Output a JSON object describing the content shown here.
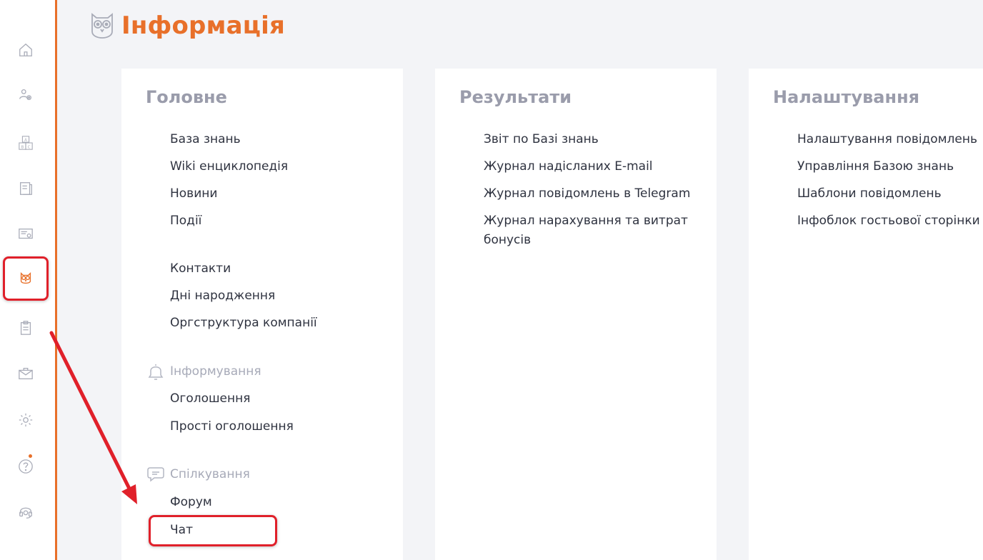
{
  "header": {
    "title": "Інформація",
    "icon": "owl-icon"
  },
  "sidebar": {
    "accent": "#e8702a",
    "items": [
      {
        "name": "home-icon"
      },
      {
        "name": "users-settings-icon"
      },
      {
        "name": "abc-blocks-icon"
      },
      {
        "name": "notebook-icon"
      },
      {
        "name": "certificate-icon"
      },
      {
        "name": "owl-icon",
        "active": true
      },
      {
        "name": "clipboard-icon"
      },
      {
        "name": "mail-icon"
      },
      {
        "name": "gear-icon"
      },
      {
        "name": "help-icon",
        "notification": true
      },
      {
        "name": "support-icon"
      }
    ]
  },
  "cards": {
    "main": {
      "title": "Головне",
      "links": [
        "База знань",
        "Wiki енциклопедія",
        "Новини",
        "Події"
      ],
      "links2": [
        "Контакти",
        "Дні народження",
        "Оргструктура компанії"
      ],
      "informing": {
        "title": "Інформування",
        "icon": "bell-icon",
        "links": [
          "Оголошення",
          "Прості оголошення"
        ]
      },
      "communication": {
        "title": "Спілкування",
        "icon": "chat-bubbles-icon",
        "links": [
          "Форум",
          "Чат"
        ]
      }
    },
    "results": {
      "title": "Результати",
      "links": [
        "Звіт по Базі знань",
        "Журнал надісланих E-mail",
        "Журнал повідомлень в Telegram",
        "Журнал нарахування та витрат",
        "бонусів"
      ]
    },
    "settings": {
      "title": "Налаштування",
      "links": [
        "Налаштування повідомлень",
        "Управління Базою знань",
        "Шаблони повідомлень",
        "Інфоблок гостьової сторінки"
      ]
    }
  },
  "colors": {
    "accent": "#e8702a",
    "annotation": "#e0202a",
    "muted": "#9a9cab",
    "text": "#2f3340"
  }
}
